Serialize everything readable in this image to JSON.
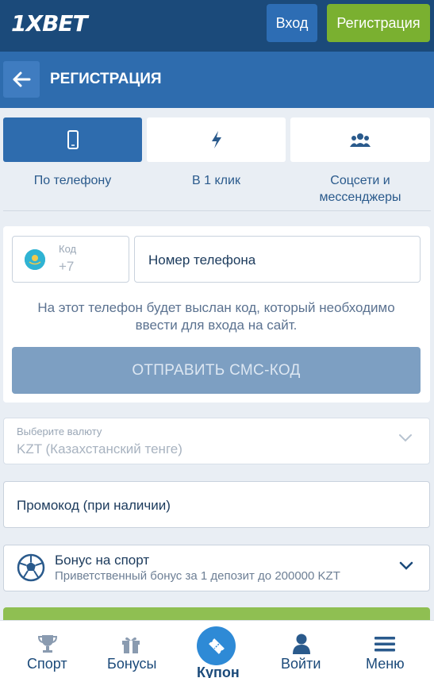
{
  "header": {
    "logo": "1XBET",
    "login_label": "Вход",
    "register_label": "Регистрация"
  },
  "page": {
    "title": "РЕГИСТРАЦИЯ"
  },
  "tabs": [
    {
      "label": "По телефону",
      "icon": "phone-icon",
      "active": true
    },
    {
      "label": "В 1 клик",
      "icon": "lightning-icon",
      "active": false
    },
    {
      "label_line1": "Соцсети и",
      "label_line2": "мессенджеры",
      "icon": "users-icon",
      "active": false
    }
  ],
  "phone_form": {
    "code_label": "Код",
    "code_value": "+7",
    "phone_placeholder": "Номер телефона",
    "hint_line1": "На этот телефон будет выслан код, который необходимо",
    "hint_line2": "ввести для входа на сайт.",
    "send_button": "ОТПРАВИТЬ СМС-КОД"
  },
  "currency": {
    "label": "Выберите валюту",
    "value": "KZT  (Казахстанский тенге)"
  },
  "promo": {
    "placeholder": "Промокод (при наличии)"
  },
  "bonus": {
    "title": "Бонус на спорт",
    "subtitle": "Приветственный бонус за 1 депозит до 200000 KZT"
  },
  "bottom_nav": [
    {
      "label": "Спорт",
      "icon": "trophy-icon"
    },
    {
      "label": "Бонусы",
      "icon": "gift-icon"
    },
    {
      "label": "Купон",
      "icon": "ticket-icon"
    },
    {
      "label": "Войти",
      "icon": "user-icon"
    },
    {
      "label": "Меню",
      "icon": "menu-icon"
    }
  ],
  "colors": {
    "header_bg": "#1b4a7a",
    "title_bar_bg": "#2e6cae",
    "accent_green": "#7ab030",
    "button_blue": "#2d6db4",
    "page_bg": "#e9eef4"
  }
}
